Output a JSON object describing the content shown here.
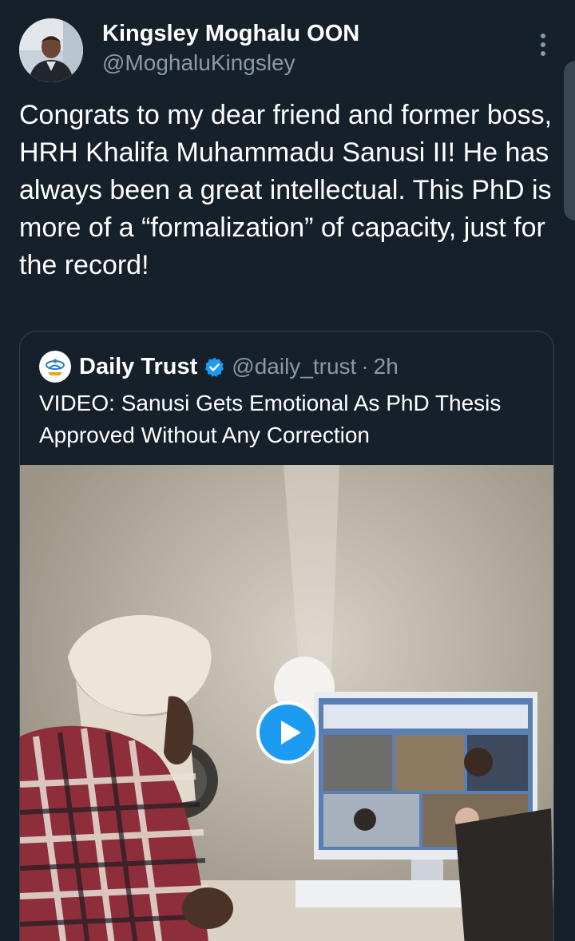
{
  "author": {
    "display_name": "Kingsley Moghalu OON",
    "handle": "@MoghaluKingsley",
    "avatar_icon": "profile-photo"
  },
  "tweet": {
    "text": "Congrats to my dear friend and former boss, HRH Khalifa Muhammadu Sanusi II! He has always been a great intellectual. This PhD is more of a “formalization” of capacity, just for the record!"
  },
  "quote": {
    "display_name": "Daily Trust",
    "handle": "@daily_trust",
    "separator": "·",
    "time": "2h",
    "text": "VIDEO: Sanusi Gets Emotional As PhD Thesis Approved Without Any Correction",
    "verified_icon": "verified-badge-icon",
    "media": {
      "type": "video",
      "play_icon": "play-icon"
    }
  },
  "colors": {
    "background": "#15202b",
    "text_primary": "#ffffff",
    "text_secondary": "#8b98a5",
    "border": "#38444d",
    "accent": "#1d9bf0"
  }
}
